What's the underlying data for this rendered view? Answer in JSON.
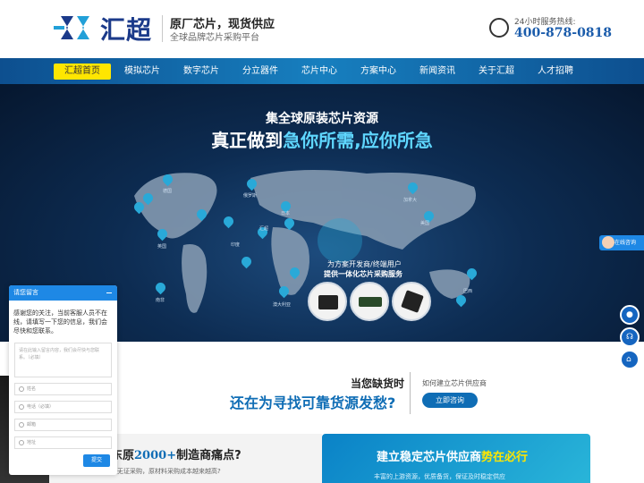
{
  "header": {
    "logo_text": "汇超",
    "slogan_main": "原厂芯片，现货供应",
    "slogan_sub": "全球品牌芯片采购平台",
    "hotline_label": "24小时服务热线:",
    "hotline_number": "400-878-0818"
  },
  "nav": {
    "items": [
      {
        "label": "汇超首页",
        "active": true
      },
      {
        "label": "模拟芯片"
      },
      {
        "label": "数字芯片"
      },
      {
        "label": "分立器件"
      },
      {
        "label": "芯片中心"
      },
      {
        "label": "方案中心"
      },
      {
        "label": "新闻资讯"
      },
      {
        "label": "关于汇超"
      },
      {
        "label": "人才招聘"
      }
    ]
  },
  "banner": {
    "title1": "集全球原装芯片资源",
    "title2_prefix": "真正做到",
    "title2_highlight": "急你所需,应你所急",
    "promo_line1": "为方案开发商/终端用户",
    "promo_line2": "提供一体化芯片采购服务",
    "cities": [
      "俄罗斯",
      "加拿大",
      "美国",
      "汇超",
      "印度",
      "澳大利亚",
      "巴西",
      "英国",
      "德国",
      "日本",
      "南非"
    ]
  },
  "float": {
    "online_label": "在线咨询"
  },
  "message": {
    "title": "请您留言",
    "intro": "感谢您的关注，当前客服人员不在线，请填写一下您的信息，我们会尽快和您联系。",
    "textarea_placeholder": "请在此输入留言内容，我们会尽快与您联系。（必填）",
    "name_placeholder": "姓名",
    "phone_placeholder": "电话（必填）",
    "email_placeholder": "邮箱",
    "address_placeholder": "地址",
    "submit": "提交"
  },
  "middle": {
    "question1": "当您缺货时",
    "question2_prefix": "还在为",
    "question2_main": "寻找可靠货源发愁?",
    "how_label": "如何建立芯片供应商",
    "consult_btn": "立即咨询"
  },
  "bottom": {
    "left_prefix": "东原",
    "left_num": "2000+",
    "left_suffix": "制造商痛点?",
    "left_line": "因无证采购，原材料采购成本越来越高?",
    "right_prefix": "建立稳定芯片供应商",
    "right_highlight": "势在必行",
    "right_sub": "丰富的上游资源，优质备货，保证及时稳定供应"
  }
}
